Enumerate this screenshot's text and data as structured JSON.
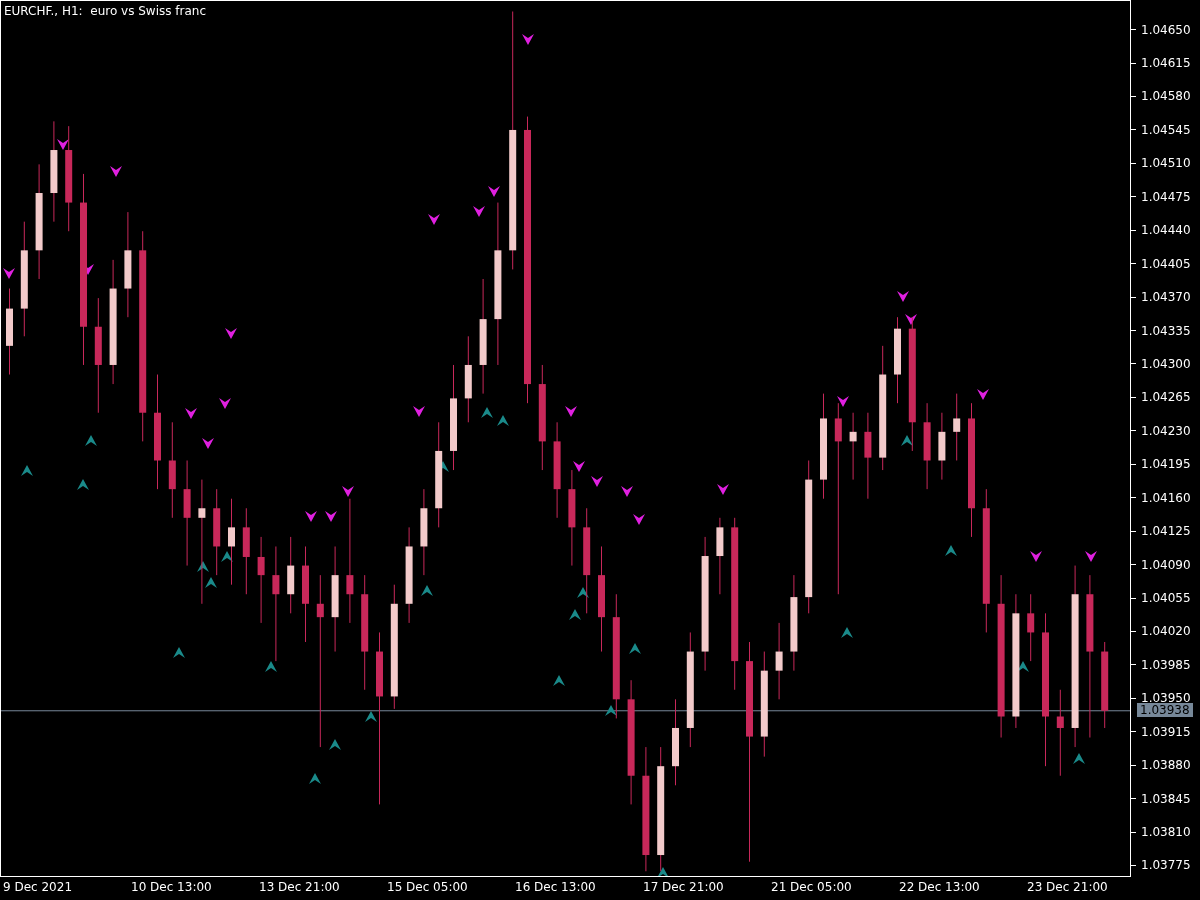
{
  "chart": {
    "title": "EURCHF., H1:  euro vs Swiss franc",
    "time_labels": [
      "9 Dec 2021",
      "10 Dec 13:00",
      "13 Dec 21:00",
      "15 Dec 05:00",
      "16 Dec 13:00",
      "17 Dec 21:00",
      "21 Dec 05:00",
      "22 Dec 13:00",
      "23 Dec 21:00"
    ],
    "chart_data": {
      "type": "candlestick",
      "ylim": [
        1.03764,
        1.04681
      ],
      "ref_lines": [
        {
          "axis": "y",
          "value": 1.03938,
          "label": "1.03938",
          "color": "#778899"
        }
      ],
      "yticks": [
        {
          "value": 1.0465,
          "label": "1.04650"
        },
        {
          "value": 1.04615,
          "label": "1.04615"
        },
        {
          "value": 1.0458,
          "label": "1.04580"
        },
        {
          "value": 1.04545,
          "label": "1.04545"
        },
        {
          "value": 1.0451,
          "label": "1.04510"
        },
        {
          "value": 1.04475,
          "label": "1.04475"
        },
        {
          "value": 1.0444,
          "label": "1.04440"
        },
        {
          "value": 1.04405,
          "label": "1.04405"
        },
        {
          "value": 1.0437,
          "label": "1.04370"
        },
        {
          "value": 1.04335,
          "label": "1.04335"
        },
        {
          "value": 1.043,
          "label": "1.04300"
        },
        {
          "value": 1.04265,
          "label": "1.04265"
        },
        {
          "value": 1.0423,
          "label": "1.04230"
        },
        {
          "value": 1.04195,
          "label": "1.04195"
        },
        {
          "value": 1.0416,
          "label": "1.04160"
        },
        {
          "value": 1.04125,
          "label": "1.04125"
        },
        {
          "value": 1.0409,
          "label": "1.04090"
        },
        {
          "value": 1.04055,
          "label": "1.04055"
        },
        {
          "value": 1.0402,
          "label": "1.04020"
        },
        {
          "value": 1.03985,
          "label": "1.03985"
        },
        {
          "value": 1.0395,
          "label": "1.03950"
        },
        {
          "value": 1.03915,
          "label": "1.03915"
        },
        {
          "value": 1.0388,
          "label": "1.03880"
        },
        {
          "value": 1.03845,
          "label": "1.03845"
        },
        {
          "value": 1.0381,
          "label": "1.03810"
        },
        {
          "value": 1.03775,
          "label": "1.03775"
        }
      ],
      "categories": [
        null,
        null,
        null,
        null,
        null,
        null,
        null,
        null,
        null,
        null,
        null,
        null,
        null,
        null,
        null,
        null,
        null,
        null,
        null,
        null,
        null,
        null,
        null,
        null,
        null,
        null,
        null,
        null,
        null,
        null,
        null,
        null,
        null,
        null,
        null,
        null,
        null,
        null,
        null,
        null,
        null,
        null,
        null,
        null,
        null,
        null,
        null,
        null,
        null,
        null,
        null,
        null,
        null,
        null,
        null,
        null,
        null,
        null,
        null,
        null,
        null,
        null,
        null,
        null,
        null,
        null,
        null,
        null,
        null,
        null,
        null,
        null,
        null,
        null,
        null
      ],
      "ohlc": [
        [
          1.0432,
          1.0438,
          1.0429,
          1.04359
        ],
        [
          1.04359,
          1.0445,
          1.0433,
          1.0442
        ],
        [
          1.0442,
          1.0451,
          1.0439,
          1.0448
        ],
        [
          1.0448,
          1.04555,
          1.0445,
          1.04525
        ],
        [
          1.04525,
          1.0455,
          1.0444,
          1.0447
        ],
        [
          1.0447,
          1.045,
          1.043,
          1.0434
        ],
        [
          1.0434,
          1.0437,
          1.0425,
          1.043
        ],
        [
          1.043,
          1.0441,
          1.0428,
          1.0438
        ],
        [
          1.0438,
          1.0446,
          1.0435,
          1.0442
        ],
        [
          1.0442,
          1.0444,
          1.0422,
          1.0425
        ],
        [
          1.0425,
          1.0429,
          1.0417,
          1.042
        ],
        [
          1.042,
          1.0424,
          1.0414,
          1.0417
        ],
        [
          1.0417,
          1.042,
          1.0409,
          1.0414
        ],
        [
          1.0414,
          1.0418,
          1.0405,
          1.0415
        ],
        [
          1.0415,
          1.0417,
          1.0408,
          1.0411
        ],
        [
          1.0411,
          1.0416,
          1.0407,
          1.0413
        ],
        [
          1.0413,
          1.0415,
          1.0406,
          1.04099
        ],
        [
          1.04099,
          1.0412,
          1.0403,
          1.0408
        ],
        [
          1.0408,
          1.0411,
          1.0399,
          1.0406
        ],
        [
          1.0406,
          1.0412,
          1.0404,
          1.0409
        ],
        [
          1.0409,
          1.0411,
          1.0401,
          1.0405
        ],
        [
          1.0405,
          1.0408,
          1.039,
          1.04036
        ],
        [
          1.04036,
          1.0411,
          1.04,
          1.0408
        ],
        [
          1.0408,
          1.0416,
          1.0403,
          1.0406
        ],
        [
          1.0406,
          1.0408,
          1.0396,
          1.04
        ],
        [
          1.04,
          1.0402,
          1.0384,
          1.03953
        ],
        [
          1.03953,
          1.0407,
          1.0394,
          1.0405
        ],
        [
          1.0405,
          1.0413,
          1.0403,
          1.0411
        ],
        [
          1.0411,
          1.0417,
          1.0408,
          1.0415
        ],
        [
          1.0415,
          1.0424,
          1.0413,
          1.0421
        ],
        [
          1.0421,
          1.043,
          1.0419,
          1.04265
        ],
        [
          1.04265,
          1.0433,
          1.0424,
          1.043
        ],
        [
          1.043,
          1.0439,
          1.0427,
          1.04348
        ],
        [
          1.04348,
          1.0447,
          1.043,
          1.0442
        ],
        [
          1.0442,
          1.0467,
          1.044,
          1.04546
        ],
        [
          1.04546,
          1.0456,
          1.0426,
          1.0428
        ],
        [
          1.0428,
          1.043,
          1.0419,
          1.0422
        ],
        [
          1.0422,
          1.0424,
          1.0414,
          1.0417
        ],
        [
          1.0417,
          1.0419,
          1.0409,
          1.0413
        ],
        [
          1.0413,
          1.0415,
          1.0404,
          1.0408
        ],
        [
          1.0408,
          1.0411,
          1.04,
          1.04036
        ],
        [
          1.04036,
          1.0406,
          1.0393,
          1.0395
        ],
        [
          1.0395,
          1.0397,
          1.0384,
          1.0387
        ],
        [
          1.0387,
          1.039,
          1.0377,
          1.03787
        ],
        [
          1.03787,
          1.039,
          1.0377,
          1.0388
        ],
        [
          1.0388,
          1.0395,
          1.0386,
          1.0392
        ],
        [
          1.0392,
          1.0402,
          1.039,
          1.04
        ],
        [
          1.04,
          1.0412,
          1.0398,
          1.041
        ],
        [
          1.041,
          1.0414,
          1.0406,
          1.0413
        ],
        [
          1.0413,
          1.0414,
          1.0396,
          1.0399
        ],
        [
          1.0399,
          1.0401,
          1.0378,
          1.03911
        ],
        [
          1.03911,
          1.04,
          1.0389,
          1.0398
        ],
        [
          1.0398,
          1.0403,
          1.0395,
          1.04
        ],
        [
          1.04,
          1.0408,
          1.0398,
          1.04057
        ],
        [
          1.04057,
          1.042,
          1.0404,
          1.0418
        ],
        [
          1.0418,
          1.0427,
          1.0416,
          1.04244
        ],
        [
          1.04244,
          1.0426,
          1.0406,
          1.0422
        ],
        [
          1.0422,
          1.0425,
          1.0418,
          1.0423
        ],
        [
          1.0423,
          1.0425,
          1.0416,
          1.04203
        ],
        [
          1.04203,
          1.0432,
          1.0419,
          1.0429
        ],
        [
          1.0429,
          1.0435,
          1.0426,
          1.04338
        ],
        [
          1.04338,
          1.0435,
          1.0421,
          1.0424
        ],
        [
          1.0424,
          1.0426,
          1.0417,
          1.042
        ],
        [
          1.042,
          1.0425,
          1.0418,
          1.0423
        ],
        [
          1.0423,
          1.0427,
          1.042,
          1.04244
        ],
        [
          1.04244,
          1.0426,
          1.0412,
          1.0415
        ],
        [
          1.0415,
          1.0417,
          1.0402,
          1.0405
        ],
        [
          1.0405,
          1.0408,
          1.0391,
          1.03932
        ],
        [
          1.03932,
          1.0406,
          1.0392,
          1.0404
        ],
        [
          1.0404,
          1.0406,
          1.0399,
          1.0402
        ],
        [
          1.0402,
          1.0404,
          1.0388,
          1.03932
        ],
        [
          1.03932,
          1.0396,
          1.0387,
          1.0392
        ],
        [
          1.0392,
          1.0409,
          1.039,
          1.0406
        ],
        [
          1.0406,
          1.0408,
          1.0391,
          1.04
        ],
        [
          1.04,
          1.0401,
          1.0392,
          1.03938
        ]
      ]
    }
  }
}
